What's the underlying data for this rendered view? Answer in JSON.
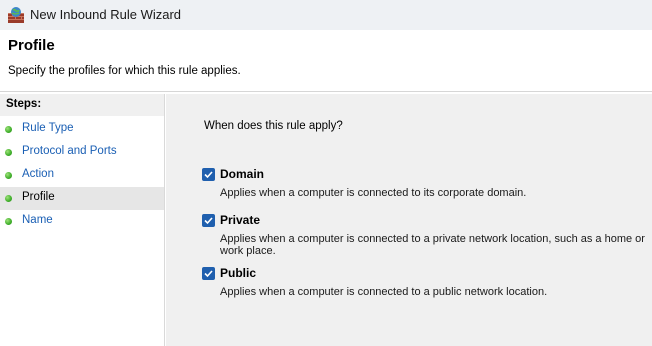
{
  "window": {
    "title": "New Inbound Rule Wizard"
  },
  "header": {
    "title": "Profile",
    "subtitle": "Specify the profiles for which this rule applies."
  },
  "steps": {
    "heading": "Steps:",
    "items": [
      {
        "label": "Rule Type",
        "current": false
      },
      {
        "label": "Protocol and Ports",
        "current": false
      },
      {
        "label": "Action",
        "current": false
      },
      {
        "label": "Profile",
        "current": true
      },
      {
        "label": "Name",
        "current": false
      }
    ]
  },
  "content": {
    "question": "When does this rule apply?",
    "options": [
      {
        "label": "Domain",
        "checked": true,
        "description": "Applies when a computer is connected to its corporate domain."
      },
      {
        "label": "Private",
        "checked": true,
        "description": "Applies when a computer is connected to a private network location, such as a home or work place."
      },
      {
        "label": "Public",
        "checked": true,
        "description": "Applies when a computer is connected to a public network location."
      }
    ]
  },
  "colors": {
    "accent": "#1f5fae",
    "link": "#1a5fb4",
    "step_dot": "#3fae2a",
    "content_bg": "#f0f0f0"
  },
  "icons": {
    "app": "firewall-icon",
    "step": "green-dot-icon",
    "check": "checkmark-icon"
  }
}
